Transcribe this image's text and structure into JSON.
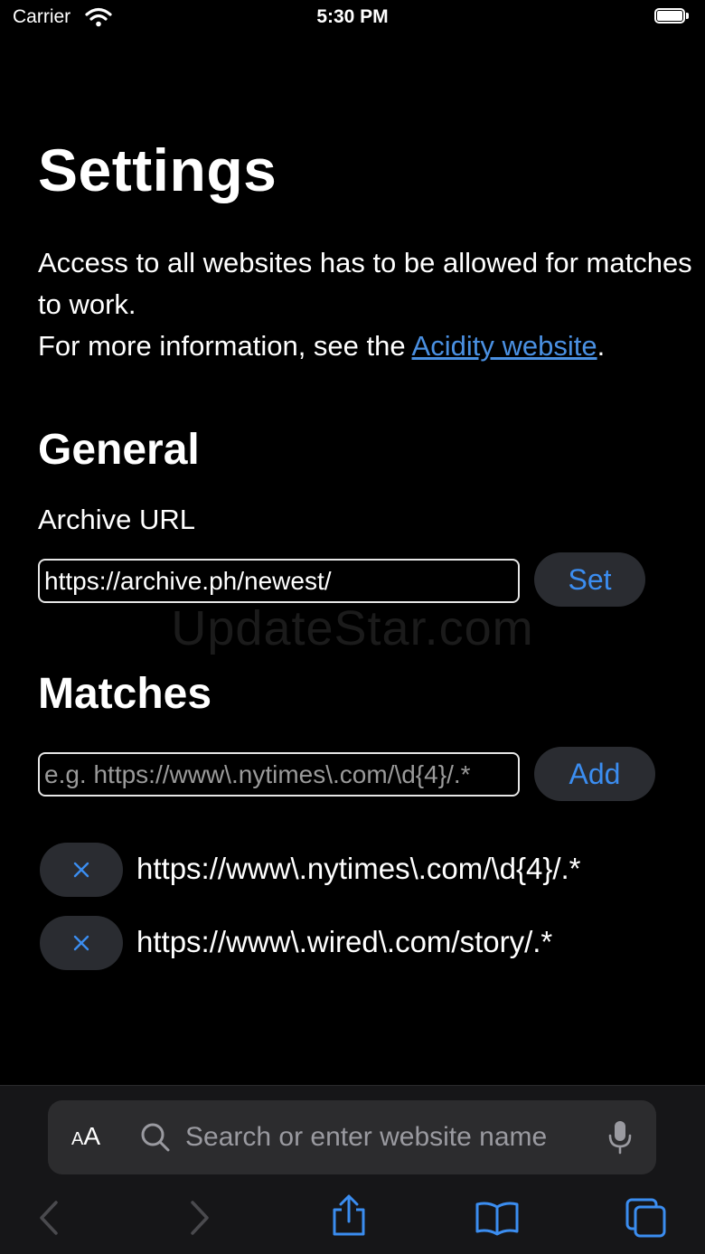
{
  "status_bar": {
    "carrier": "Carrier",
    "time": "5:30 PM"
  },
  "page": {
    "title": "Settings",
    "intro_line1": "Access to all websites has to be allowed for matches to work.",
    "intro_line2_prefix": "For more information, see the ",
    "intro_link": "Acidity website",
    "intro_line2_suffix": "."
  },
  "general": {
    "heading": "General",
    "archive_label": "Archive URL",
    "archive_value": "https://archive.ph/newest/",
    "set_label": "Set"
  },
  "watermark": "UpdateStar.com",
  "matches": {
    "heading": "Matches",
    "input_placeholder": "e.g. https://www\\.nytimes\\.com/\\d{4}/.*",
    "input_value": "",
    "add_label": "Add",
    "remove_label": "×",
    "items": [
      {
        "pattern": "https://www\\.nytimes\\.com/\\d{4}/.*"
      },
      {
        "pattern": "https://www\\.wired\\.com/story/.*"
      }
    ]
  },
  "browser_bar": {
    "aa_small": "A",
    "aa_large": "A",
    "address_placeholder": "Search or enter website name",
    "icons": [
      "search-icon",
      "microphone-icon",
      "back-icon",
      "forward-icon",
      "share-icon",
      "bookmarks-icon",
      "tabs-icon"
    ]
  },
  "colors": {
    "background": "#000000",
    "accent_blue": "#3b8df0",
    "link_blue": "#4a90e2",
    "button_bg": "#2a2c31",
    "toolbar_bg": "#161618"
  }
}
